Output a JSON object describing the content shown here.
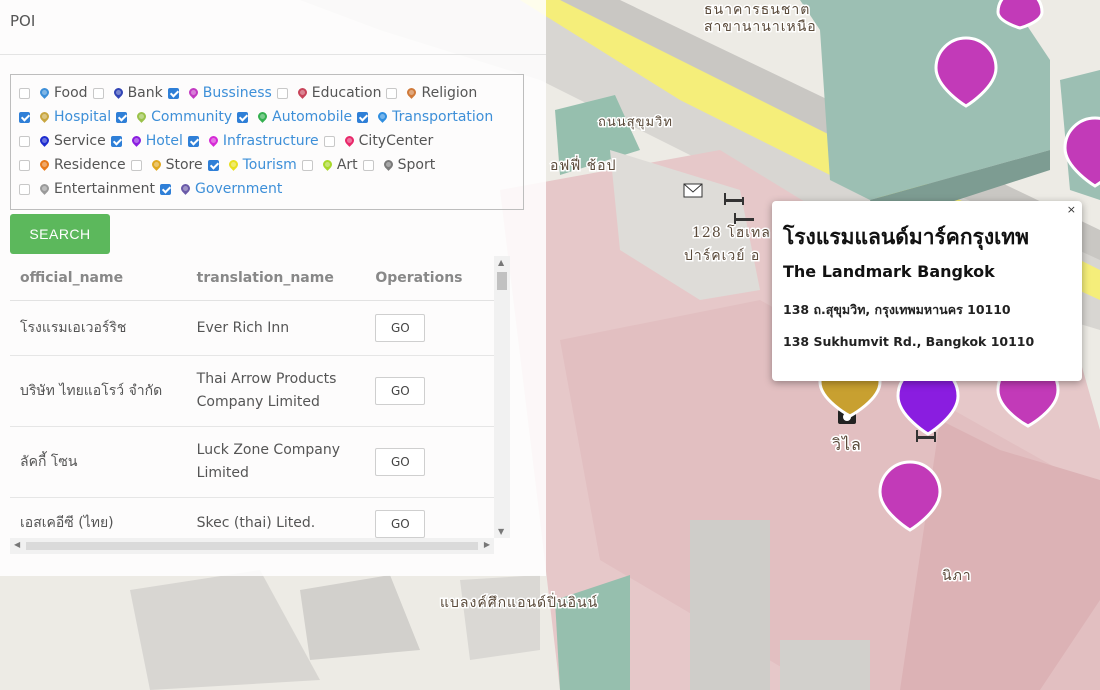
{
  "panel": {
    "title": "POI"
  },
  "categories": [
    {
      "label": "Food",
      "checked": false,
      "color": "#3d8fd8"
    },
    {
      "label": "Bank",
      "checked": false,
      "color": "#3245b5"
    },
    {
      "label": "Bussiness",
      "checked": true,
      "color": "#c23ac2"
    },
    {
      "label": "Education",
      "checked": false,
      "color": "#c8445a"
    },
    {
      "label": "Religion",
      "checked": false,
      "color": "#d07a3a"
    },
    {
      "label": "Hospital",
      "checked": true,
      "color": "#c8a640"
    },
    {
      "label": "Community",
      "checked": true,
      "color": "#9ac24a"
    },
    {
      "label": "Automobile",
      "checked": true,
      "color": "#35b050"
    },
    {
      "label": "Transportation",
      "checked": true,
      "color": "#2f8ee0"
    },
    {
      "label": "Service",
      "checked": false,
      "color": "#1d2ccf"
    },
    {
      "label": "Hotel",
      "checked": true,
      "color": "#8a1de0"
    },
    {
      "label": "Infrastructure",
      "checked": true,
      "color": "#d62ad6"
    },
    {
      "label": "CityCenter",
      "checked": false,
      "color": "#e8286a"
    },
    {
      "label": "Residence",
      "checked": false,
      "color": "#e87a1a"
    },
    {
      "label": "Store",
      "checked": false,
      "color": "#e0a820"
    },
    {
      "label": "Tourism",
      "checked": true,
      "color": "#e8e020"
    },
    {
      "label": "Art",
      "checked": false,
      "color": "#a8d82a"
    },
    {
      "label": "Sport",
      "checked": false,
      "color": "#7a7a7a"
    },
    {
      "label": "Entertainment",
      "checked": false,
      "color": "#9a9a9a"
    },
    {
      "label": "Government",
      "checked": true,
      "color": "#6a5aa8"
    }
  ],
  "search": {
    "label": "SEARCH"
  },
  "table": {
    "headers": [
      "official_name",
      "translation_name",
      "Operations"
    ],
    "rows": [
      {
        "official": "โรงแรมเอเวอร์ริช",
        "translation": "Ever Rich Inn",
        "action": "GO"
      },
      {
        "official": "บริษัท ไทยแอโรว์ จำกัด",
        "translation": "Thai Arrow Products Company Limited",
        "action": "GO"
      },
      {
        "official": "ลัคกี้ โซน",
        "translation": "Luck Zone Company Limited",
        "action": "GO"
      },
      {
        "official": "เอสเคอีซี (ไทย)",
        "translation": "Skec (thai) Lited.",
        "action": "GO"
      }
    ]
  },
  "popup": {
    "close": "×",
    "title_th": "โรงแรมแลนด์มาร์คกรุงเทพ",
    "title_en": "The Landmark Bangkok",
    "address_th": "138 ถ.สุขุมวิท, กรุงเทพมหานคร 10110",
    "address_en": "138 Sukhumvit Rd., Bangkok 10110"
  },
  "map": {
    "labels": {
      "bank": "ธนาคารธนชาต",
      "bank_branch": "สาขานานาเหนือ",
      "road": "ถนนสุขุมวิท",
      "coffee_shop": "อฟฟี่ ช้อป",
      "parkway": "128 โฮเทล",
      "parkway2": "ปาร์คเวย์ อ",
      "vila": "วิไล",
      "nipa": "นิภา",
      "landmark_plaza": "แบลงค์ศึกแอนด์ปิ่นอินน์"
    },
    "marker_colors": {
      "magenta": "#c23ab8",
      "purple": "#8a1de0",
      "gold": "#c8a030"
    }
  }
}
